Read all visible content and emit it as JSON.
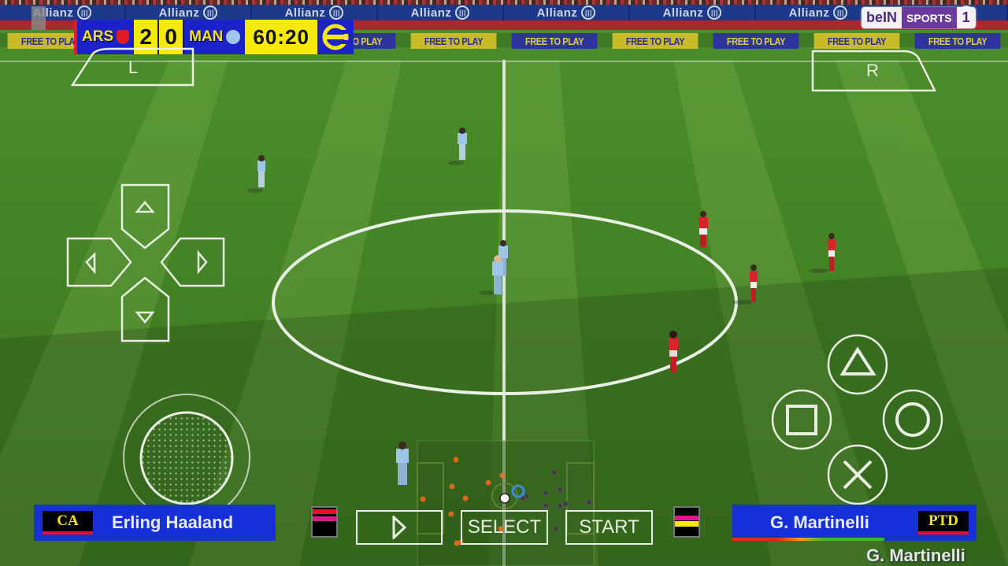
{
  "stadium": {
    "sponsor_board": "Allianz",
    "sponsor_count": 8,
    "ad_board": "FREE TO PLAY",
    "ad_board_colors": [
      "y",
      "b",
      "y",
      "b",
      "y",
      "b",
      "y",
      "b",
      "y",
      "b"
    ]
  },
  "scoreboard": {
    "home_team": "ARS",
    "home_score": "2",
    "away_team": "MAN",
    "away_score": "0",
    "match_time": "60:20",
    "home_crest_color": "#e01b22",
    "away_crest_color": "#9fc6ea",
    "brand_icon": "efootball-logo-icon"
  },
  "broadcaster": {
    "part1": "beIN",
    "part2": "SPORTS",
    "part3": "1"
  },
  "controls": {
    "l_button": "L",
    "r_button": "R",
    "dpad": [
      "up",
      "left",
      "right",
      "down"
    ],
    "face_buttons": [
      "triangle",
      "square",
      "circle",
      "cross"
    ],
    "play_button": "play",
    "select_label": "SELECT",
    "start_label": "START"
  },
  "players": {
    "left_player": {
      "position": "CA",
      "name": "Erling Haaland",
      "stamina_colors": [
        "#e4112a",
        "#d81b8b"
      ]
    },
    "right_player": {
      "position": "PTD",
      "name": "G. Martinelli",
      "stamina_colors": [
        "#d81b8b",
        "#f5e51b"
      ],
      "bar_colors": [
        "#e02a22",
        "#f0a020",
        "#3db82e"
      ]
    },
    "controlled_player_label": "G. Martinelli"
  },
  "colors": {
    "home_kit": "#d9242b",
    "away_kit": "#9ec4e6",
    "pitch": "#3f7a24"
  },
  "radar": {
    "home_dots": 10,
    "away_dots": 10
  }
}
